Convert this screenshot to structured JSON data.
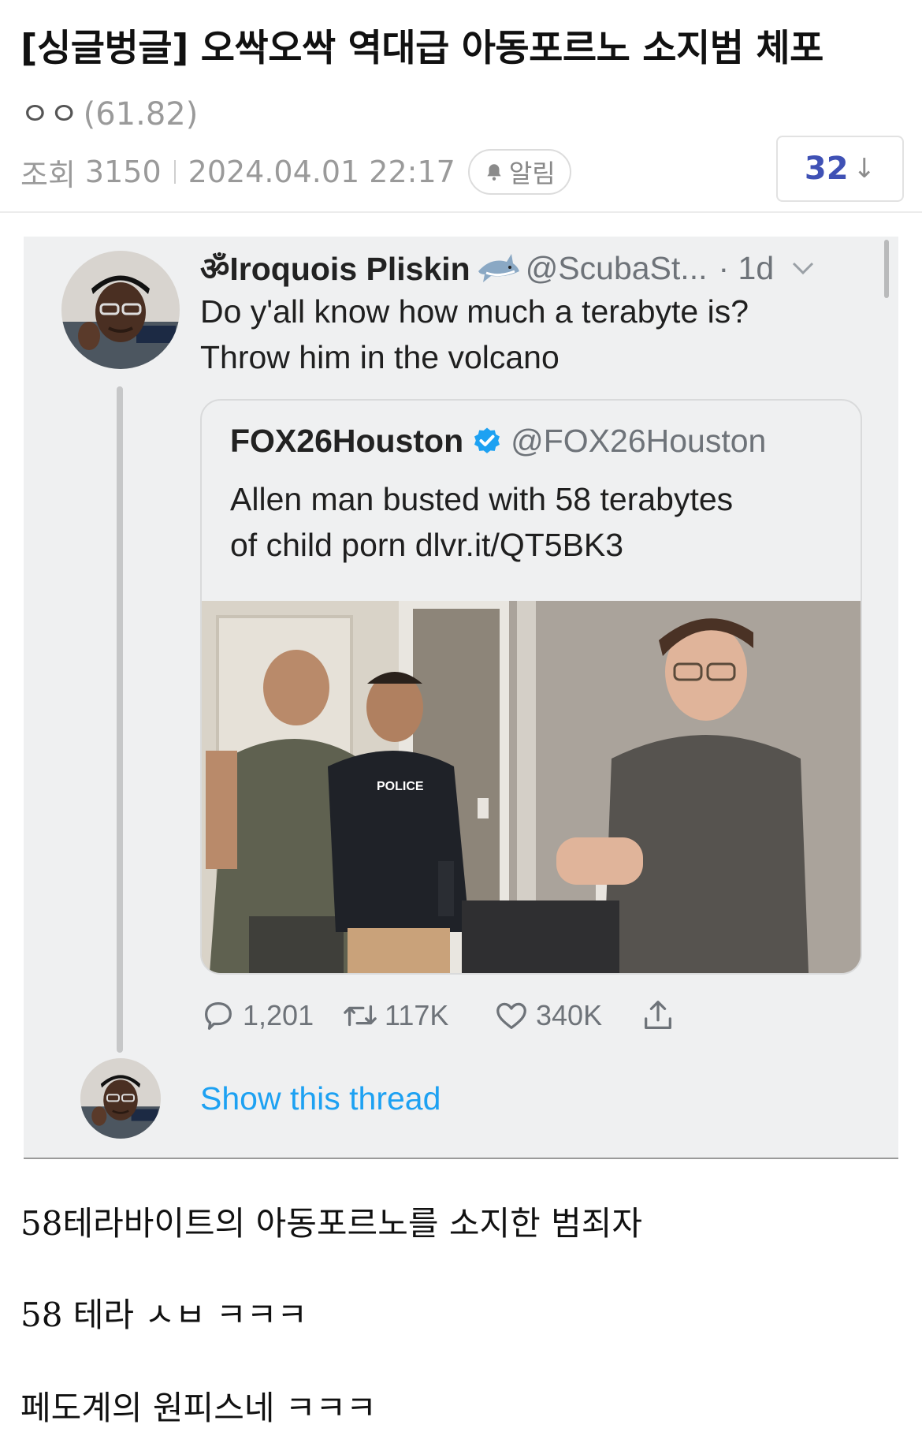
{
  "post": {
    "title": "[싱글벙글] 오싹오싹 역대급 아동포르노 소지범 체포",
    "author": "ㅇㅇ",
    "author_level": "(61.82)",
    "views_label": "조회",
    "views": "3150",
    "datetime": "2024.04.01 22:17",
    "alarm_label": "알림",
    "votes": "32",
    "vote_arrow": "↓"
  },
  "tweet": {
    "name_prefix": "ॐ",
    "name": "Iroquois Pliskin",
    "handle": "@ScubaSt...",
    "time": "· 1d",
    "text_line1": "Do y'all know how much a terabyte is?",
    "text_line2": "Throw him in the volcano",
    "quote": {
      "name": "FOX26Houston",
      "handle": "@FOX26Houston",
      "text_line1": "Allen man busted with 58 terabytes",
      "text_line2": "of child porn dlvr.it/QT5BK3",
      "photo_vest_text": "POLICE"
    },
    "actions": {
      "replies": "1,201",
      "retweets": "117K",
      "likes": "340K"
    },
    "show_thread": "Show this thread"
  },
  "body": {
    "line1": "58테라바이트의 아동포르노를 소지한 범죄자",
    "line2": "58 테라 ㅅㅂ ㅋㅋㅋ",
    "line3": "페도계의 원피스네 ㅋㅋㅋ"
  },
  "colors": {
    "link": "#1da1f2",
    "vote": "#3f51b5",
    "verified": "#1da1f2",
    "embed_bg": "#eff0f1"
  },
  "icons": [
    "bell-icon",
    "shark-emoji-icon",
    "chevron-down-icon",
    "verified-badge-icon",
    "reply-icon",
    "retweet-icon",
    "like-icon",
    "share-icon"
  ]
}
